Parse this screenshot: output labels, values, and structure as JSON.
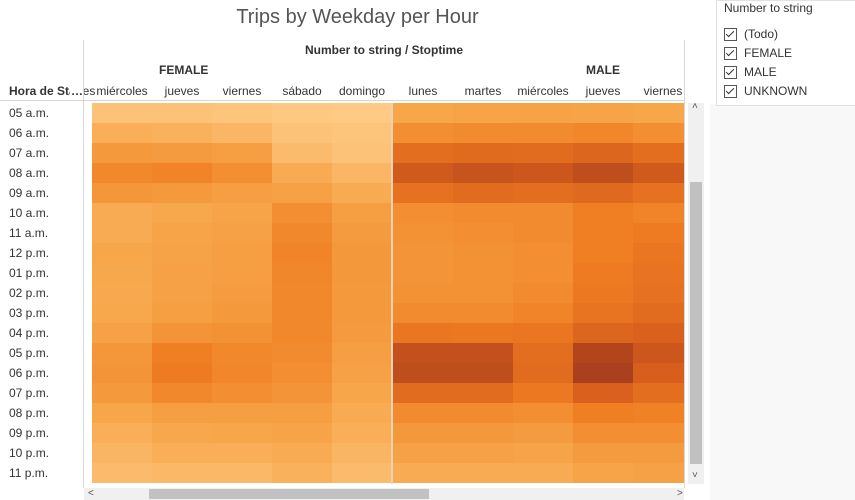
{
  "title": "Trips by Weekday per Hour",
  "column_title": "Number to string / Stoptime",
  "row_title": "Hora de Sta..",
  "row_title_ellipsis": "…",
  "groups": [
    "FEMALE",
    "MALE"
  ],
  "legend": {
    "title": "Number to string",
    "items": [
      "(Todo)",
      "FEMALE",
      "MALE",
      "UNKNOWN"
    ]
  },
  "scroll": {
    "left_arrow": "<",
    "right_arrow": ">",
    "up_arrow": "˄",
    "down_arrow": "˅"
  },
  "chart_data": {
    "type": "heatmap",
    "title": "Trips by Weekday per Hour",
    "x_title": "Number to string / Stoptime",
    "y_title": "Hora de Sta..",
    "color_scale": [
      "#ffcf8c",
      "#f7a64a",
      "#f07e22",
      "#d65d1c",
      "#a23a1e"
    ],
    "hours": [
      "05 a.m.",
      "06 a.m.",
      "07 a.m.",
      "08 a.m.",
      "09 a.m.",
      "10 a.m.",
      "11 a.m.",
      "12 p.m.",
      "01 p.m.",
      "02 p.m.",
      "03 p.m.",
      "04 p.m.",
      "05 p.m.",
      "06 p.m.",
      "07 p.m.",
      "08 p.m.",
      "09 p.m.",
      "10 p.m.",
      "11 p.m."
    ],
    "panels": [
      {
        "group": "FEMALE",
        "days": [
          "martes",
          "miércoles",
          "jueves",
          "viernes",
          "sábado",
          "domingo"
        ],
        "visible_labels": [
          "miércoles",
          "jueves",
          "viernes",
          "sábado",
          "domingo"
        ],
        "values": [
          [
            0.1,
            0.08,
            0.08,
            0.06,
            0.04,
            0.03
          ],
          [
            0.22,
            0.2,
            0.18,
            0.15,
            0.08,
            0.06
          ],
          [
            0.35,
            0.33,
            0.32,
            0.3,
            0.12,
            0.08
          ],
          [
            0.45,
            0.44,
            0.46,
            0.4,
            0.22,
            0.15
          ],
          [
            0.36,
            0.35,
            0.33,
            0.3,
            0.28,
            0.22
          ],
          [
            0.22,
            0.22,
            0.24,
            0.26,
            0.4,
            0.3
          ],
          [
            0.24,
            0.22,
            0.26,
            0.28,
            0.44,
            0.32
          ],
          [
            0.26,
            0.25,
            0.27,
            0.3,
            0.46,
            0.34
          ],
          [
            0.25,
            0.24,
            0.28,
            0.3,
            0.45,
            0.34
          ],
          [
            0.24,
            0.23,
            0.28,
            0.31,
            0.44,
            0.33
          ],
          [
            0.26,
            0.24,
            0.3,
            0.33,
            0.44,
            0.33
          ],
          [
            0.3,
            0.28,
            0.36,
            0.38,
            0.44,
            0.32
          ],
          [
            0.4,
            0.35,
            0.5,
            0.44,
            0.42,
            0.3
          ],
          [
            0.42,
            0.36,
            0.52,
            0.45,
            0.4,
            0.28
          ],
          [
            0.36,
            0.33,
            0.44,
            0.4,
            0.36,
            0.25
          ],
          [
            0.28,
            0.25,
            0.3,
            0.3,
            0.3,
            0.22
          ],
          [
            0.22,
            0.2,
            0.24,
            0.25,
            0.26,
            0.2
          ],
          [
            0.18,
            0.16,
            0.2,
            0.2,
            0.22,
            0.16
          ],
          [
            0.14,
            0.12,
            0.14,
            0.14,
            0.18,
            0.12
          ]
        ]
      },
      {
        "group": "MALE",
        "days": [
          "lunes",
          "martes",
          "miércoles",
          "jueves",
          "viernes"
        ],
        "visible_labels": [
          "lunes",
          "martes",
          "miércoles",
          "jueves",
          "viernes"
        ],
        "values": [
          [
            0.25,
            0.26,
            0.27,
            0.26,
            0.25
          ],
          [
            0.4,
            0.42,
            0.42,
            0.45,
            0.4
          ],
          [
            0.62,
            0.65,
            0.64,
            0.68,
            0.62
          ],
          [
            0.78,
            0.82,
            0.8,
            0.86,
            0.78
          ],
          [
            0.6,
            0.64,
            0.62,
            0.66,
            0.6
          ],
          [
            0.4,
            0.42,
            0.42,
            0.5,
            0.46
          ],
          [
            0.38,
            0.4,
            0.42,
            0.5,
            0.52
          ],
          [
            0.36,
            0.38,
            0.4,
            0.5,
            0.56
          ],
          [
            0.36,
            0.38,
            0.4,
            0.52,
            0.58
          ],
          [
            0.38,
            0.38,
            0.42,
            0.54,
            0.6
          ],
          [
            0.42,
            0.42,
            0.46,
            0.58,
            0.64
          ],
          [
            0.56,
            0.55,
            0.56,
            0.68,
            0.72
          ],
          [
            0.84,
            0.84,
            0.62,
            0.92,
            0.8
          ],
          [
            0.86,
            0.86,
            0.64,
            0.96,
            0.74
          ],
          [
            0.64,
            0.64,
            0.54,
            0.72,
            0.62
          ],
          [
            0.42,
            0.42,
            0.4,
            0.5,
            0.48
          ],
          [
            0.34,
            0.34,
            0.32,
            0.4,
            0.4
          ],
          [
            0.28,
            0.28,
            0.26,
            0.32,
            0.32
          ],
          [
            0.22,
            0.22,
            0.22,
            0.26,
            0.28
          ]
        ]
      }
    ]
  }
}
